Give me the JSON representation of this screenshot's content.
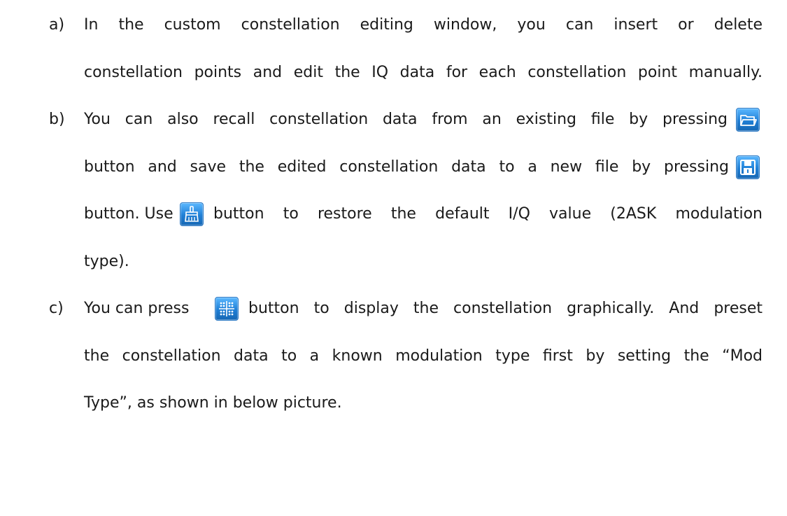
{
  "items": [
    {
      "marker": "a)",
      "lines": [
        "In the custom constellation editing window, you can insert or delete",
        "constellation points and edit the IQ data for each constellation point manually."
      ]
    },
    {
      "marker": "b)",
      "lines": [
        "You can also recall constellation data from an existing file by pressing",
        "button and save the edited constellation data to a new file by pressing",
        "button. Use",
        "button to restore the default I/Q value (2ASK modulation",
        "type)."
      ]
    },
    {
      "marker": "c)",
      "lines": [
        "You can press",
        "button to display the constellation graphically. And preset",
        "the constellation data to a known modulation type first by setting the “Mod",
        "Type”, as shown in below picture."
      ]
    }
  ],
  "icons": {
    "open": "folder-open-icon",
    "save": "floppy-save-icon",
    "clear": "broom-clear-icon",
    "graph": "constellation-grid-icon"
  },
  "colors": {
    "text": "#1a1a1a",
    "icon_bg": "#1f7fd6"
  }
}
